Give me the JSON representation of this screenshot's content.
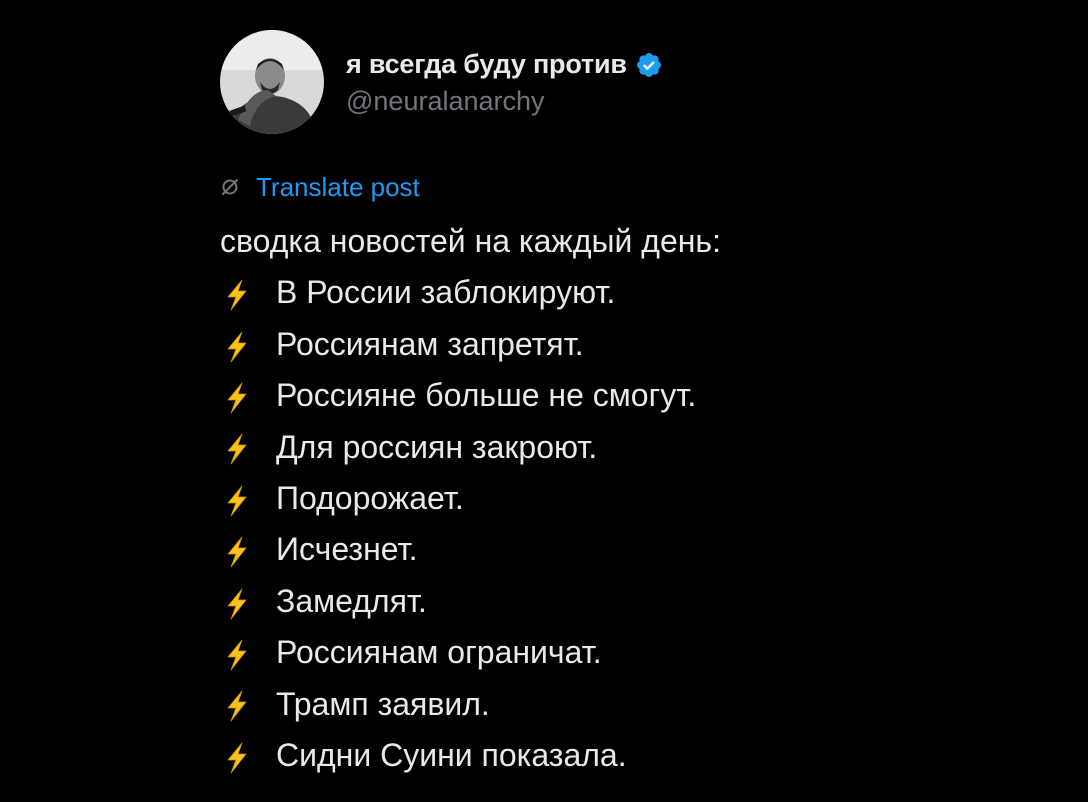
{
  "author": {
    "display_name": "я всегда буду против",
    "handle": "@neuralanarchy",
    "verified_icon": "verified-badge-icon",
    "avatar": "avatar"
  },
  "translate": {
    "icon": "translate-icon",
    "label": "Translate post"
  },
  "post": {
    "intro": "сводка новостей на каждый день:",
    "bullet_icon": "lightning-icon",
    "items": [
      "В России заблокируют.",
      "Россиянам запретят.",
      "Россияне больше не смогут.",
      "Для россиян закроют.",
      "Подорожает.",
      "Исчезнет.",
      "Замедлят.",
      "Россиянам ограничат.",
      "Трамп заявил.",
      "Сидни Суини показала."
    ]
  },
  "colors": {
    "background": "#000000",
    "text": "#e7e9ea",
    "muted": "#71767b",
    "accent": "#1d9bf0",
    "bolt": "#fcc21b"
  }
}
